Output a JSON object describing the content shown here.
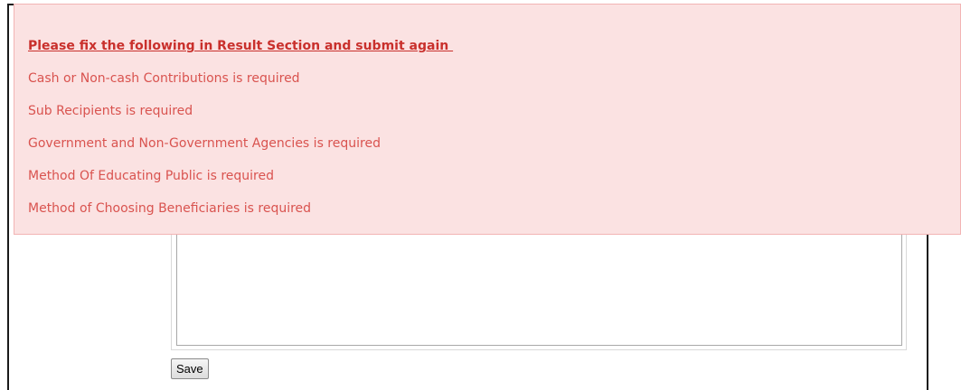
{
  "alert": {
    "title": "Please fix the following in Result Section and submit again ",
    "errors": [
      "Cash or Non-cash Contributions is required",
      "Sub Recipients is required",
      "Government and Non-Government Agencies is required",
      "Method Of Educating Public is required",
      "Method of Choosing Beneficiaries is required"
    ],
    "colors": {
      "background": "#fbe2e2",
      "border": "#f2b4b4",
      "text": "#d9534f"
    }
  },
  "form": {
    "textarea_value": "",
    "save_label": "Save"
  }
}
